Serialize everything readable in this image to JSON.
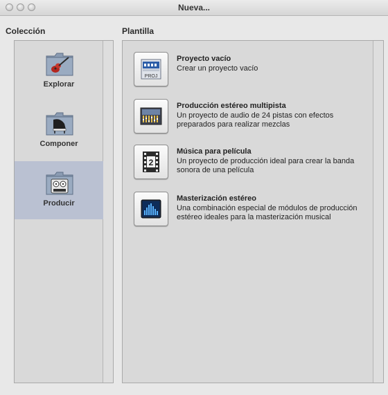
{
  "window": {
    "title": "Nueva..."
  },
  "collection": {
    "label": "Colección",
    "items": [
      {
        "label": "Explorar",
        "icon": "guitar-folder-icon",
        "selected": false
      },
      {
        "label": "Componer",
        "icon": "piano-folder-icon",
        "selected": false
      },
      {
        "label": "Producir",
        "icon": "tape-recorder-folder-icon",
        "selected": true
      }
    ]
  },
  "templates": {
    "label": "Plantilla",
    "items": [
      {
        "title": "Proyecto vacío",
        "description": "Crear un proyecto vacío",
        "icon": "empty-project-icon",
        "icon_text": "PROJ"
      },
      {
        "title": "Producción estéreo multipista",
        "description": "Un proyecto de audio de 24 pistas con efectos preparados para realizar mezclas",
        "icon": "mixing-console-icon"
      },
      {
        "title": "Música para película",
        "description": "Un proyecto de producción ideal para crear la banda sonora de una película",
        "icon": "film-strip-icon",
        "icon_text": "2"
      },
      {
        "title": "Masterización estéreo",
        "description": "Una combinación especial de módulos de producción estéreo ideales para la masterización musical",
        "icon": "spectrum-meter-icon"
      }
    ]
  },
  "colors": {
    "selection": "#bac1d2",
    "folder": "#8a9bb2",
    "panel": "#d9d9d9"
  }
}
